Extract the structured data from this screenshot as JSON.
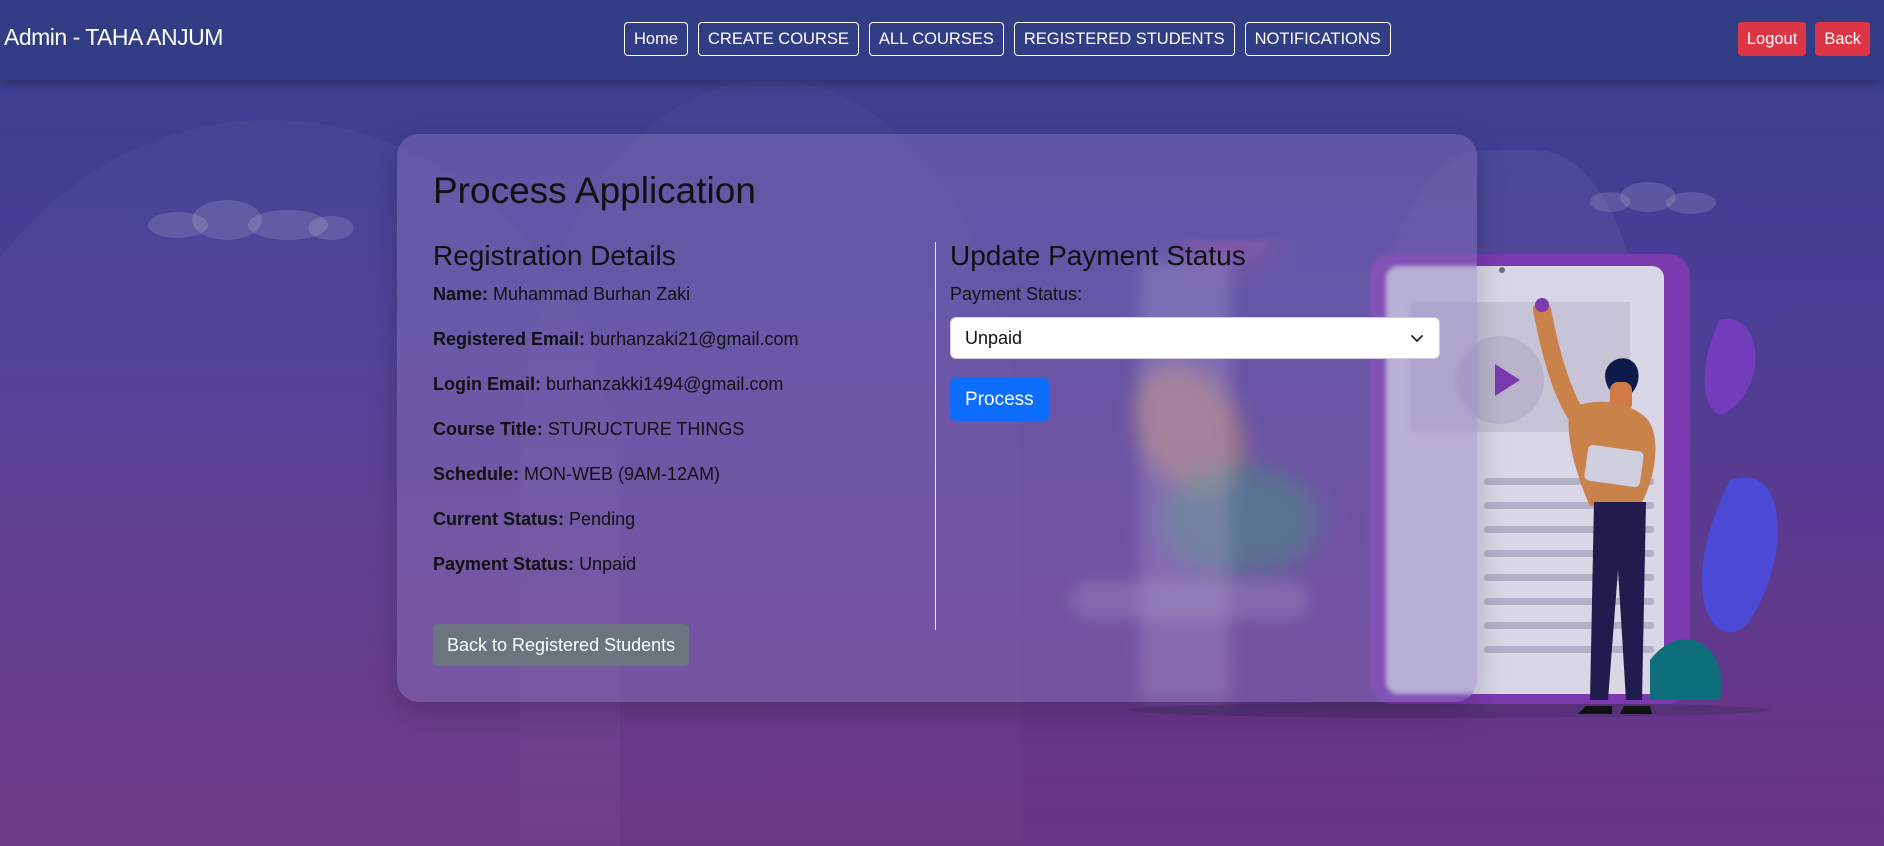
{
  "navbar": {
    "brand": "Admin - TAHA ANJUM",
    "links": [
      "Home",
      "CREATE COURSE",
      "ALL COURSES",
      "REGISTERED STUDENTS",
      "NOTIFICATIONS"
    ],
    "logout_label": "Logout",
    "back_label": "Back"
  },
  "page": {
    "title": "Process Application"
  },
  "registration": {
    "heading": "Registration Details",
    "fields": [
      {
        "label": "Name:",
        "value": "Muhammad Burhan Zaki"
      },
      {
        "label": "Registered Email:",
        "value": "burhanzaki21@gmail.com"
      },
      {
        "label": "Login Email:",
        "value": "burhanzakki1494@gmail.com"
      },
      {
        "label": "Course Title:",
        "value": "STURUCTURE THINGS"
      },
      {
        "label": "Schedule:",
        "value": "MON-WEB (9AM-12AM)"
      },
      {
        "label": "Current Status:",
        "value": "Pending"
      },
      {
        "label": "Payment Status:",
        "value": "Unpaid"
      }
    ]
  },
  "payment": {
    "heading": "Update Payment Status",
    "label": "Payment Status:",
    "selected": "Unpaid",
    "process_label": "Process"
  },
  "back_to_students_label": "Back to Registered Students",
  "colors": {
    "navbar": "#333d86",
    "danger": "#dc3545",
    "primary": "#0d6efd",
    "secondary": "#6c757d"
  },
  "icons": [
    "chevron-down-icon",
    "play-icon"
  ]
}
